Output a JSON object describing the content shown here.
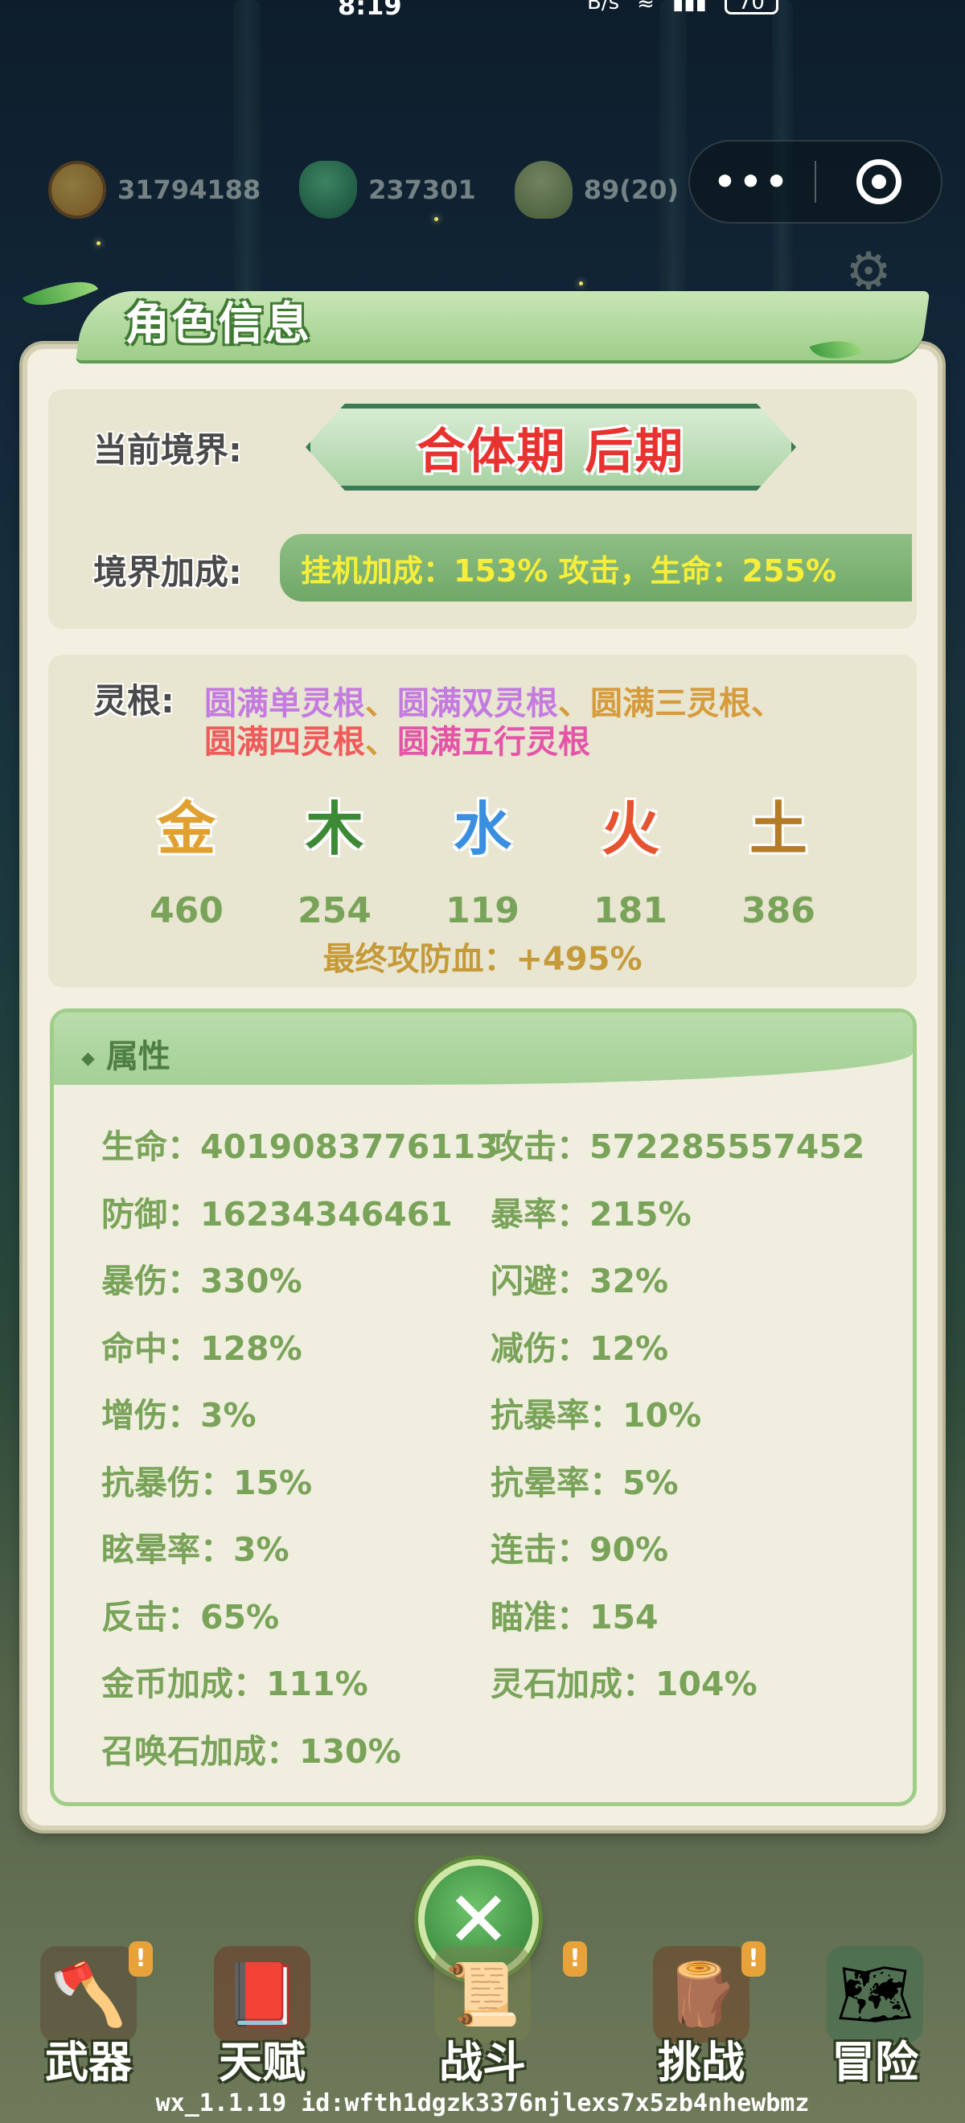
{
  "status_bar": {
    "time": "8:19",
    "net_speed": "B/s",
    "battery": "70"
  },
  "resources": [
    {
      "icon": "coin-icon",
      "value": "31794188"
    },
    {
      "icon": "spirit-stone-icon",
      "value": "237301"
    },
    {
      "icon": "bud-icon",
      "value": "89(20)"
    }
  ],
  "capsule": {
    "more": "•••"
  },
  "panel": {
    "title": "角色信息",
    "realm_label": "当前境界:",
    "realm_value": "合体期 后期",
    "bonus_label": "境界加成:",
    "bonus_value": "挂机加成：153%   攻击，生命：255%"
  },
  "roots": {
    "label": "灵根:",
    "items": [
      {
        "text": "圆满单灵根",
        "color": "#c47be0"
      },
      {
        "text": "圆满双灵根",
        "color": "#c47be0"
      },
      {
        "text": "圆满三灵根",
        "color": "#d69b3a"
      },
      {
        "text": "圆满四灵根",
        "color": "#ef5a5a"
      },
      {
        "text": "圆满五行灵根",
        "color": "#e455a8"
      }
    ],
    "separator": "、",
    "elements": [
      {
        "glyph": "金",
        "value": "460",
        "color": "#e0a132"
      },
      {
        "glyph": "木",
        "value": "254",
        "color": "#3c8a35"
      },
      {
        "glyph": "水",
        "value": "119",
        "color": "#3a8fe0"
      },
      {
        "glyph": "火",
        "value": "181",
        "color": "#e5532f"
      },
      {
        "glyph": "土",
        "value": "386",
        "color": "#b57c26"
      }
    ],
    "final": "最终攻防血：+495%"
  },
  "attributes": {
    "title": "属性",
    "items": [
      "生命：4019083776113",
      "攻击：572285557452",
      "防御：16234346461",
      "暴率：215%",
      "暴伤：330%",
      "闪避：32%",
      "命中：128%",
      "减伤：12%",
      "增伤：3%",
      "抗暴率：10%",
      "抗暴伤：15%",
      "抗晕率：5%",
      "眩晕率：3%",
      "连击：90%",
      "反击：65%",
      "瞄准：154",
      "金币加成：111%",
      "灵石加成：104%",
      "召唤石加成：130%"
    ]
  },
  "close_button": "✕",
  "nav": [
    {
      "label": "武器",
      "icon": "axe-icon",
      "badge": "!"
    },
    {
      "label": "天赋",
      "icon": "book-icon",
      "badge": ""
    },
    {
      "label": "战斗",
      "icon": "scroll-icon",
      "badge": "!"
    },
    {
      "label": "挑战",
      "icon": "stump-icon",
      "badge": "!"
    },
    {
      "label": "冒险",
      "icon": "map-icon",
      "badge": ""
    }
  ],
  "footer": "wx_1.1.19 id:wfth1dgzk3376njlexs7x5zb4nhewbmz"
}
